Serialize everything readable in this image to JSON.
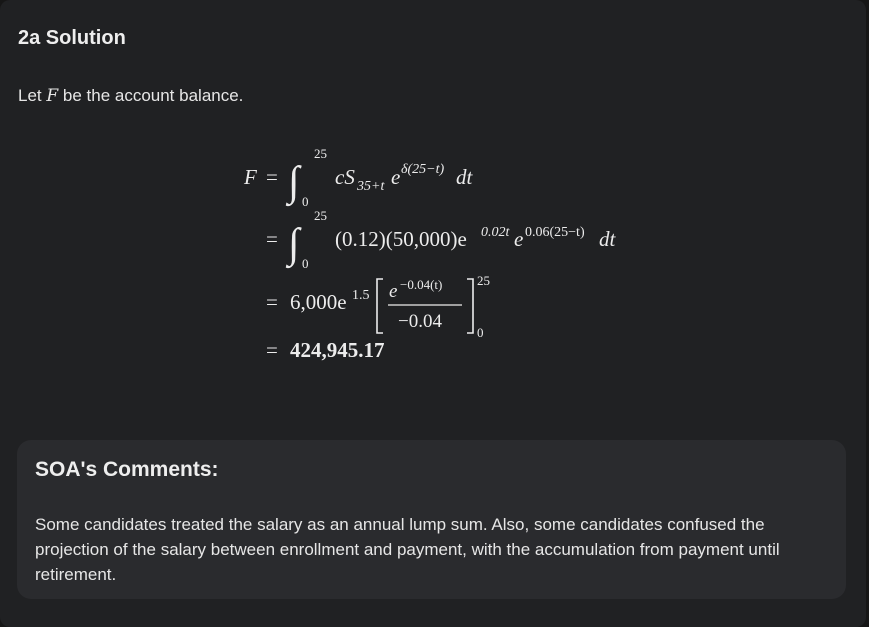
{
  "solution": {
    "title": "2a Solution",
    "intro_before": "Let ",
    "intro_var": "F",
    "intro_after": " be the account balance."
  },
  "equation": {
    "lhs": "F",
    "eq": "=",
    "integral": "∫",
    "upper_limit": "25",
    "lower_limit": "0",
    "line1_integrand": "cS",
    "line1_subscript": "35+t",
    "line1_e": "e",
    "line1_exponent": "δ(25−t)",
    "line1_dt": "dt",
    "line2_integrand": "(0.12)(50,000)e",
    "line2_exp1": "0.02t",
    "line2_e": "e",
    "line2_exp2": "0.06(25−t)",
    "line2_dt": "dt",
    "line3_coef": "6,000e",
    "line3_exp": "1.5",
    "line3_num_e": "e",
    "line3_num_exp": "−0.04(t)",
    "line3_den": "−0.04",
    "line3_upper": "25",
    "line3_lower": "0",
    "line4_result": "424,945.17"
  },
  "comments": {
    "heading": "SOA's Comments:",
    "body": "Some candidates treated the salary as an annual lump sum. Also, some candidates confused the projection of the salary between enrollment and payment, with the accumulation from payment until retirement."
  }
}
